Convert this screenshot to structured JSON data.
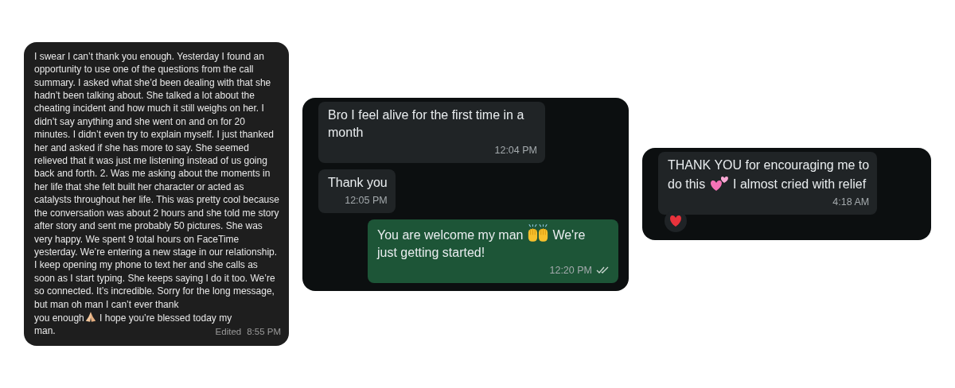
{
  "panels": [
    {
      "kind": "imessage",
      "messages": [
        {
          "outgoing": false,
          "lines": [
            [
              {
                "kind": "text",
                "text": "I swear I can’t thank you enough. Yesterday I found an opportunity to use one of the questions from the call summary. I asked what she’d been dealing with that she hadn’t been talking about. She talked a lot about the cheating incident and how much it still weighs on her. I didn’t say anything and she went on and on for 20 minutes. I didn’t even try to explain myself. I just thanked her and asked if she has more to say. She seemed relieved that it was just me listening instead of us going back and forth. 2. Was me asking about the moments in her life that she felt built her character or acted as catalysts throughout her life. This was pretty cool because the conversation was about 2 hours and she told me story after story and sent me probably 50 pictures. She was very happy. We spent 9 total hours on FaceTime yesterday. We’re entering a new stage in our relationship. I keep opening my phone to text her and she calls as soon as I start typing. She keeps saying I do it too. We’re so connected. It’s incredible. Sorry for the long message, but man oh man I can’t ever thank"
              }
            ],
            [
              {
                "kind": "text",
                "text": "you enough"
              },
              {
                "kind": "praying"
              },
              {
                "kind": "text",
                "text": " I hope you’re blessed today my"
              }
            ],
            [
              {
                "kind": "text",
                "text": "man."
              }
            ]
          ],
          "edited": "Edited",
          "time": "8:55 PM"
        }
      ]
    },
    {
      "kind": "whatsapp",
      "messages": [
        {
          "outgoing": false,
          "lines": [
            [
              {
                "kind": "text",
                "text": "Bro I feel alive for the first time in a month"
              }
            ]
          ],
          "time": "12:04 PM"
        },
        {
          "outgoing": false,
          "lines": [
            [
              {
                "kind": "text",
                "text": "Thank you"
              }
            ]
          ],
          "time": "12:05 PM"
        },
        {
          "outgoing": true,
          "lines": [
            [
              {
                "kind": "text",
                "text": "You are welcome my man "
              },
              {
                "kind": "raised"
              },
              {
                "kind": "text",
                "text": " We're"
              }
            ],
            [
              {
                "kind": "text",
                "text": "just getting started!"
              }
            ]
          ],
          "time": "12:20 PM",
          "read": true
        }
      ]
    },
    {
      "kind": "whatsapp",
      "messages": [
        {
          "outgoing": false,
          "lines": [
            [
              {
                "kind": "text",
                "text": "THANK YOU for encouraging me to"
              }
            ],
            [
              {
                "kind": "text",
                "text": "do this "
              },
              {
                "kind": "hearts"
              },
              {
                "kind": "text",
                "text": " I almost cried with relief"
              }
            ]
          ],
          "time": "4:18 AM",
          "heart_reaction": true
        }
      ]
    }
  ]
}
